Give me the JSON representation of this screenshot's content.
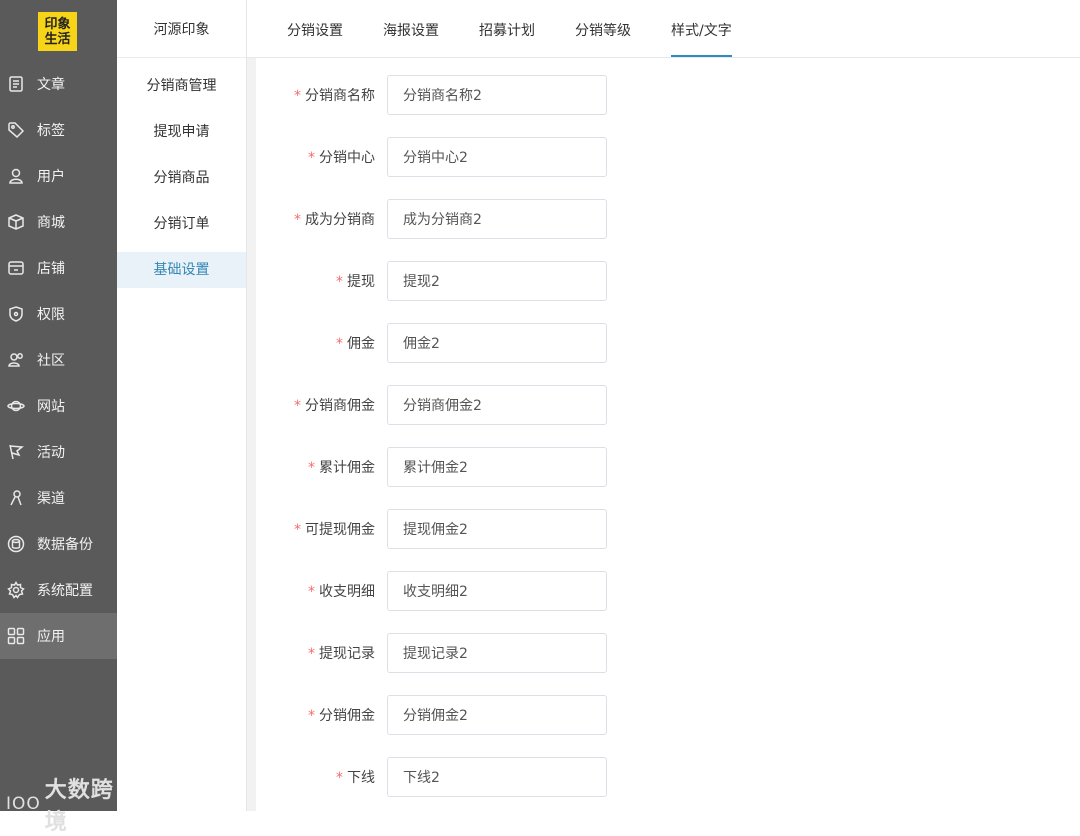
{
  "logo": {
    "text": "印象生活",
    "bg": "#f7d417"
  },
  "sidebar": {
    "items": [
      {
        "label": "文章",
        "icon": "document-icon"
      },
      {
        "label": "标签",
        "icon": "tag-icon"
      },
      {
        "label": "用户",
        "icon": "user-icon"
      },
      {
        "label": "商城",
        "icon": "box-icon"
      },
      {
        "label": "店铺",
        "icon": "store-icon"
      },
      {
        "label": "权限",
        "icon": "shield-icon"
      },
      {
        "label": "社区",
        "icon": "community-icon"
      },
      {
        "label": "网站",
        "icon": "planet-icon"
      },
      {
        "label": "活动",
        "icon": "flag-icon"
      },
      {
        "label": "渠道",
        "icon": "channel-icon"
      },
      {
        "label": "数据备份",
        "icon": "database-icon"
      },
      {
        "label": "系统配置",
        "icon": "gear-icon"
      },
      {
        "label": "应用",
        "icon": "apps-icon"
      }
    ],
    "active_index": 12
  },
  "watermark": {
    "text": "大数跨境",
    "icon_text": "IOO"
  },
  "subnav": {
    "brand": "河源印象",
    "items": [
      "分销商管理",
      "提现申请",
      "分销商品",
      "分销订单",
      "基础设置"
    ],
    "active_index": 4
  },
  "tabs": {
    "items": [
      "分销设置",
      "海报设置",
      "招募计划",
      "分销等级",
      "样式/文字"
    ],
    "active_index": 4,
    "accent": "#2d8cc4"
  },
  "form": {
    "required_mark": "*",
    "fields": [
      {
        "label": "分销商名称",
        "value": "分销商名称2"
      },
      {
        "label": "分销中心",
        "value": "分销中心2"
      },
      {
        "label": "成为分销商",
        "value": "成为分销商2"
      },
      {
        "label": "提现",
        "value": "提现2"
      },
      {
        "label": "佣金",
        "value": "佣金2"
      },
      {
        "label": "分销商佣金",
        "value": "分销商佣金2"
      },
      {
        "label": "累计佣金",
        "value": "累计佣金2"
      },
      {
        "label": "可提现佣金",
        "value": "提现佣金2"
      },
      {
        "label": "收支明细",
        "value": "收支明细2"
      },
      {
        "label": "提现记录",
        "value": "提现记录2"
      },
      {
        "label": "分销佣金",
        "value": "分销佣金2"
      },
      {
        "label": "下线",
        "value": "下线2"
      }
    ]
  }
}
